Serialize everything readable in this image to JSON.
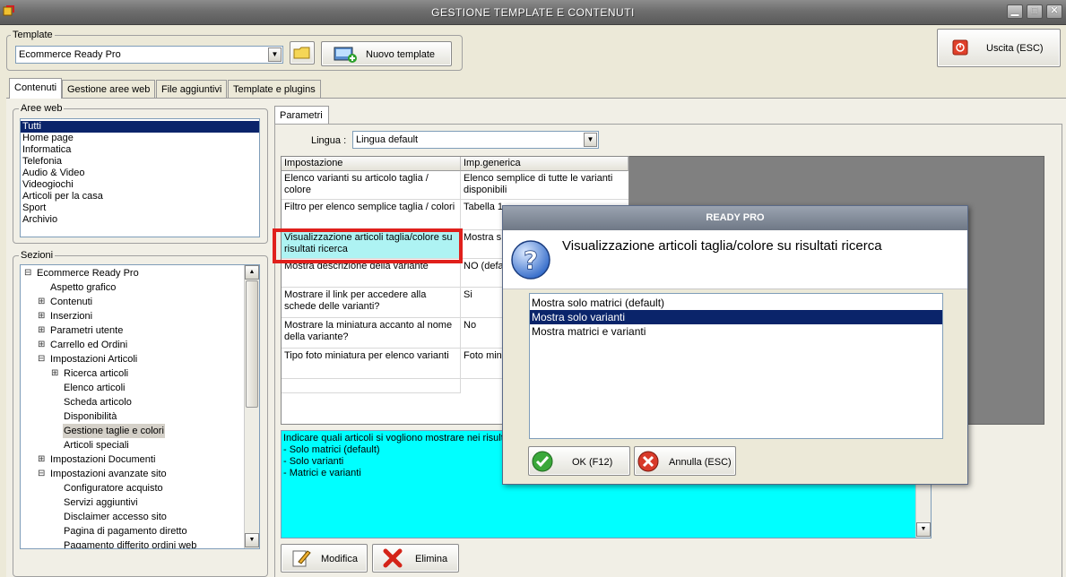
{
  "window": {
    "title": "GESTIONE TEMPLATE E CONTENUTI",
    "minimize_glyph": "▁",
    "maximize_glyph": "□",
    "close_glyph": "✕"
  },
  "template_group": {
    "label": "Template",
    "selected": "Ecommerce Ready Pro",
    "new_button": "Nuovo template"
  },
  "exit_button": "Uscita (ESC)",
  "tabs": [
    "Contenuti",
    "Gestione aree web",
    "File aggiuntivi",
    "Template e plugins"
  ],
  "aree_web": {
    "label": "Aree web",
    "items": [
      "Tutti",
      "Home page",
      "Informatica",
      "Telefonia",
      "Audio & Video",
      "Videogiochi",
      "Articoli per la casa",
      "Sport",
      "Archivio"
    ],
    "selected_index": 0
  },
  "sezioni": {
    "label": "Sezioni",
    "tree": [
      {
        "label": "Ecommerce Ready Pro",
        "level": 0,
        "expander": "⊟"
      },
      {
        "label": "Aspetto grafico",
        "level": 1,
        "expander": ""
      },
      {
        "label": "Contenuti",
        "level": 1,
        "expander": "⊞"
      },
      {
        "label": "Inserzioni",
        "level": 1,
        "expander": "⊞"
      },
      {
        "label": "Parametri utente",
        "level": 1,
        "expander": "⊞"
      },
      {
        "label": "Carrello ed Ordini",
        "level": 1,
        "expander": "⊞"
      },
      {
        "label": "Impostazioni Articoli",
        "level": 1,
        "expander": "⊟"
      },
      {
        "label": "Ricerca articoli",
        "level": 2,
        "expander": "⊞"
      },
      {
        "label": "Elenco articoli",
        "level": 2,
        "expander": ""
      },
      {
        "label": "Scheda articolo",
        "level": 2,
        "expander": ""
      },
      {
        "label": "Disponibilità",
        "level": 2,
        "expander": ""
      },
      {
        "label": "Gestione taglie e colori",
        "level": 2,
        "expander": "",
        "selected": true
      },
      {
        "label": "Articoli speciali",
        "level": 2,
        "expander": ""
      },
      {
        "label": "Impostazioni Documenti",
        "level": 1,
        "expander": "⊞"
      },
      {
        "label": "Impostazioni avanzate sito",
        "level": 1,
        "expander": "⊟"
      },
      {
        "label": "Configuratore acquisto",
        "level": 2,
        "expander": ""
      },
      {
        "label": "Servizi aggiuntivi",
        "level": 2,
        "expander": ""
      },
      {
        "label": "Disclaimer accesso sito",
        "level": 2,
        "expander": ""
      },
      {
        "label": "Pagina di pagamento diretto",
        "level": 2,
        "expander": ""
      },
      {
        "label": "Pagamento differito ordini web",
        "level": 2,
        "expander": ""
      }
    ]
  },
  "parametri": {
    "tab_label": "Parametri",
    "lingua_label": "Lingua :",
    "lingua_value": "Lingua default",
    "columns": [
      "Impostazione",
      "Imp.generica"
    ],
    "rows": [
      [
        "Elenco varianti su articolo taglia / colore",
        "Elenco semplice di tutte le varianti disponibili"
      ],
      [
        "Filtro per elenco semplice taglia / colori",
        "Tabella 1"
      ],
      [
        "Visualizzazione articoli taglia/colore su risultati ricerca",
        "Mostra s"
      ],
      [
        "Mostra descrizione della variante",
        "NO (defa"
      ],
      [
        "Mostrare il link per accedere alla schede delle varianti?",
        "Si"
      ],
      [
        "Mostrare la miniatura accanto al nome della variante?",
        "No"
      ],
      [
        "Tipo foto miniatura per elenco varianti",
        "Foto mini"
      ]
    ],
    "description_lines": [
      "Indicare quali articoli si vogliono mostrare nei risulta",
      "- Solo matrici (default)",
      "- Solo varianti",
      "- Matrici e varianti"
    ],
    "modify_button": "Modifica",
    "delete_button": "Elimina"
  },
  "dialog": {
    "title": "READY PRO",
    "question": "Visualizzazione articoli taglia/colore su risultati ricerca",
    "options": [
      "Mostra solo matrici (default)",
      "Mostra solo varianti",
      "Mostra matrici e varianti"
    ],
    "selected_index": 1,
    "ok_button": "OK (F12)",
    "cancel_button": "Annulla (ESC)"
  },
  "colors": {
    "selection": "#0a246a",
    "highlight_frame": "#e0201c",
    "description_bg": "#00ffff"
  }
}
